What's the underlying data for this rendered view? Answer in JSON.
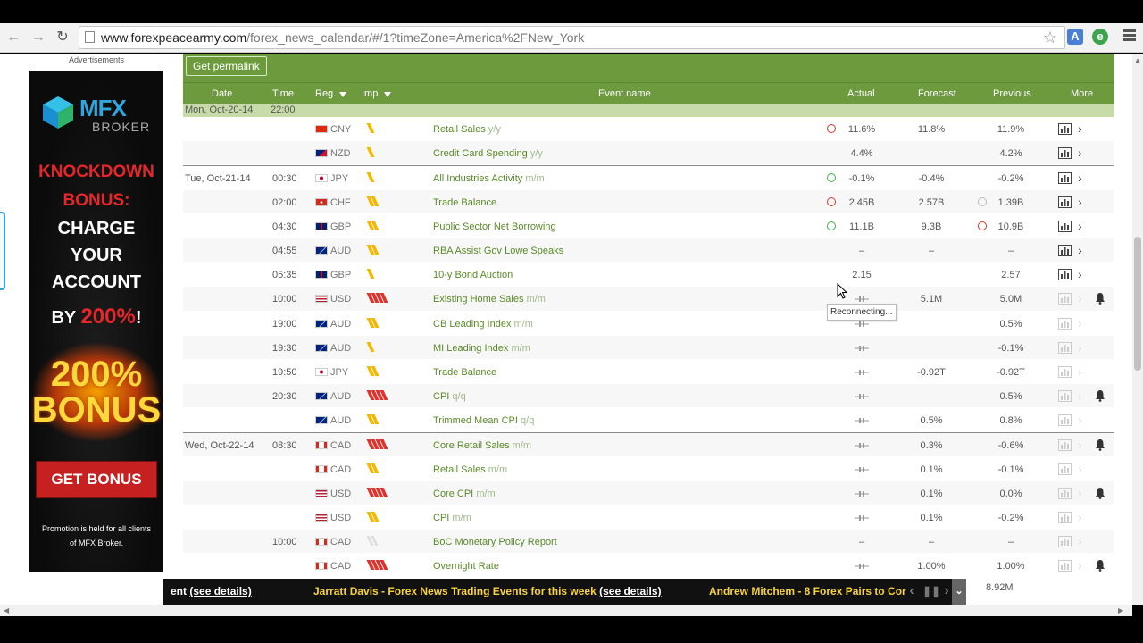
{
  "browser": {
    "url_host": "www.forexpeacearmy.com",
    "url_path": "/forex_news_calendar/#/1?timeZone=America%2FNew_York"
  },
  "ad": {
    "caption": "Advertisements",
    "brand": "MFX",
    "brand_sub": "BROKER",
    "line1": "KNOCKDOWN",
    "line2": "BONUS:",
    "line3": "CHARGE",
    "line4": "YOUR",
    "line5": "ACCOUNT",
    "by": "BY",
    "pct": "200%",
    "bang": "!",
    "burst": "200%",
    "burst2": "BONUS",
    "cta": "GET BONUS",
    "promo": "Promotion is held for all clients of MFX Broker."
  },
  "calendar": {
    "permalink": "Get permalink",
    "headers": {
      "date": "Date",
      "time": "Time",
      "reg": "Reg.",
      "imp": "Imp.",
      "event": "Event name",
      "actual": "Actual",
      "forecast": "Forecast",
      "previous": "Previous",
      "more": "More"
    },
    "day_header": {
      "date": "Mon, Oct-20-14",
      "time": "22:00"
    },
    "rows": [
      {
        "date": "",
        "time": "",
        "cur": "CNY",
        "imp": 1,
        "event": "Retail Sales",
        "unit": "y/y",
        "actual": "11.6%",
        "forecast": "11.8%",
        "previous": "11.9%",
        "dot": "-",
        "dot2": "",
        "active": true,
        "bell": false
      },
      {
        "date": "",
        "time": "",
        "cur": "NZD",
        "imp": 1,
        "event": "Credit Card Spending",
        "unit": "y/y",
        "actual": "4.4%",
        "forecast": "",
        "previous": "4.2%",
        "dot": "",
        "dot2": "",
        "active": true,
        "bell": false
      },
      {
        "date": "Tue, Oct-21-14",
        "time": "00:30",
        "cur": "JPY",
        "imp": 1,
        "event": "All Industries Activity",
        "unit": "m/m",
        "actual": "-0.1%",
        "forecast": "-0.4%",
        "previous": "-0.2%",
        "dot": "+",
        "dot2": "",
        "active": true,
        "bell": false
      },
      {
        "date": "",
        "time": "02:00",
        "cur": "CHF",
        "imp": 2,
        "event": "Trade Balance",
        "unit": "",
        "actual": "2.45B",
        "forecast": "2.57B",
        "previous": "1.39B",
        "dot": "-",
        "dot2": "o",
        "active": true,
        "bell": false
      },
      {
        "date": "",
        "time": "04:30",
        "cur": "GBP",
        "imp": 2,
        "event": "Public Sector Net Borrowing",
        "unit": "",
        "actual": "11.1B",
        "forecast": "9.3B",
        "previous": "10.9B",
        "dot": "+",
        "dot2": "-",
        "active": true,
        "bell": false
      },
      {
        "date": "",
        "time": "04:55",
        "cur": "AUD",
        "imp": 2,
        "event": "RBA Assist Gov Lowe Speaks",
        "unit": "",
        "actual": "–",
        "forecast": "–",
        "previous": "–",
        "dot": "",
        "dot2": "",
        "active": true,
        "bell": false
      },
      {
        "date": "",
        "time": "05:35",
        "cur": "GBP",
        "imp": 1,
        "event": "10-y Bond Auction",
        "unit": "",
        "actual": "2.15",
        "forecast": "",
        "previous": "2.57",
        "dot": "",
        "dot2": "",
        "active": true,
        "bell": false
      },
      {
        "date": "",
        "time": "10:00",
        "cur": "USD",
        "imp": 4,
        "event": "Existing Home Sales",
        "unit": "m/m",
        "actual": "pending",
        "forecast": "5.1M",
        "previous": "5.0M",
        "dot": "",
        "dot2": "",
        "active": false,
        "bell": true
      },
      {
        "date": "",
        "time": "19:00",
        "cur": "AUD",
        "imp": 2,
        "event": "CB Leading Index",
        "unit": "m/m",
        "actual": "pending",
        "forecast": "",
        "previous": "0.5%",
        "dot": "",
        "dot2": "",
        "active": false,
        "bell": false
      },
      {
        "date": "",
        "time": "19:30",
        "cur": "AUD",
        "imp": 1,
        "event": "MI Leading Index",
        "unit": "m/m",
        "actual": "pending",
        "forecast": "",
        "previous": "-0.1%",
        "dot": "",
        "dot2": "",
        "active": false,
        "bell": false
      },
      {
        "date": "",
        "time": "19:50",
        "cur": "JPY",
        "imp": 2,
        "event": "Trade Balance",
        "unit": "",
        "actual": "pending",
        "forecast": "-0.92T",
        "previous": "-0.92T",
        "dot": "",
        "dot2": "",
        "active": false,
        "bell": false
      },
      {
        "date": "",
        "time": "20:30",
        "cur": "AUD",
        "imp": 4,
        "event": "CPI",
        "unit": "q/q",
        "actual": "pending",
        "forecast": "",
        "previous": "0.5%",
        "dot": "",
        "dot2": "",
        "active": false,
        "bell": true
      },
      {
        "date": "",
        "time": "",
        "cur": "AUD",
        "imp": 2,
        "event": "Trimmed Mean CPI",
        "unit": "q/q",
        "actual": "pending",
        "forecast": "0.5%",
        "previous": "0.8%",
        "dot": "",
        "dot2": "",
        "active": false,
        "bell": false
      },
      {
        "date": "Wed, Oct-22-14",
        "time": "08:30",
        "cur": "CAD",
        "imp": 4,
        "event": "Core Retail Sales",
        "unit": "m/m",
        "actual": "pending",
        "forecast": "0.3%",
        "previous": "-0.6%",
        "dot": "",
        "dot2": "",
        "active": false,
        "bell": true
      },
      {
        "date": "",
        "time": "",
        "cur": "CAD",
        "imp": 2,
        "event": "Retail Sales",
        "unit": "m/m",
        "actual": "pending",
        "forecast": "0.1%",
        "previous": "-0.1%",
        "dot": "",
        "dot2": "",
        "active": false,
        "bell": false
      },
      {
        "date": "",
        "time": "",
        "cur": "USD",
        "imp": 4,
        "event": "Core CPI",
        "unit": "m/m",
        "actual": "pending",
        "forecast": "0.1%",
        "previous": "0.0%",
        "dot": "",
        "dot2": "",
        "active": false,
        "bell": true
      },
      {
        "date": "",
        "time": "",
        "cur": "USD",
        "imp": 2,
        "event": "CPI",
        "unit": "m/m",
        "actual": "pending",
        "forecast": "0.1%",
        "previous": "-0.2%",
        "dot": "",
        "dot2": "",
        "active": false,
        "bell": false
      },
      {
        "date": "",
        "time": "10:00",
        "cur": "CAD",
        "imp": 0,
        "event": "BoC Monetary Policy Report",
        "unit": "",
        "actual": "–",
        "forecast": "–",
        "previous": "–",
        "dot": "",
        "dot2": "",
        "active": false,
        "bell": false
      },
      {
        "date": "",
        "time": "",
        "cur": "CAD",
        "imp": 4,
        "event": "Overnight Rate",
        "unit": "",
        "actual": "pending",
        "forecast": "1.00%",
        "previous": "1.00%",
        "dot": "",
        "dot2": "",
        "active": false,
        "bell": true
      }
    ],
    "tooltip": "Reconnecting..."
  },
  "ticker": {
    "item1_tail": "ent",
    "item1_link": "(see details)",
    "item2": "Jarratt Davis - Forex News Trading Events for this week",
    "item2_link": "(see details)",
    "item3": "Andrew Mitchem - 8 Forex Pairs to Cor",
    "after": "8.92M"
  },
  "colors": {
    "header_green": "#6c9a3d",
    "day_band": "#c6dba7",
    "event_link": "#5a8a28",
    "importance": "#f5b800",
    "importance_high": "#e0322b"
  }
}
